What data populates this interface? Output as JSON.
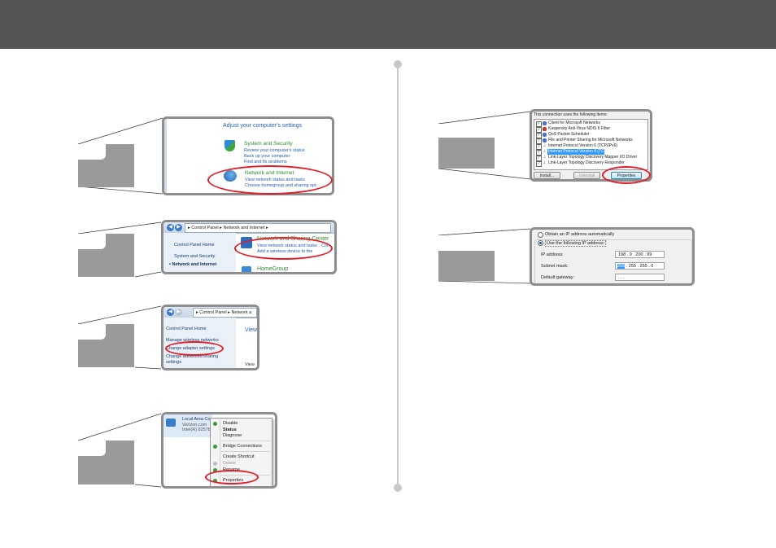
{
  "panel1": {
    "heading": "Adjust your computer's settings",
    "security_title": "System and Security",
    "security_links": [
      "Review your computer's status",
      "Back up your computer",
      "Find and fix problems"
    ],
    "network_title": "Network and Internet",
    "network_links": [
      "View network status and tasks",
      "Choose homegroup and sharing opt"
    ]
  },
  "panel2": {
    "breadcrumb": [
      "Control Panel",
      "Network and Internet"
    ],
    "sidebar": [
      "Control Panel Home",
      "System and Security",
      "Network and Internet"
    ],
    "nsc_title": "Network and Sharing Center",
    "nsc_links": [
      "View network status and tasks",
      "Con",
      "Add a wireless device to the"
    ],
    "homegroup": "HomeGroup"
  },
  "panel3": {
    "breadcrumb": [
      "Control Panel",
      "Network a"
    ],
    "sidebar": [
      "Control Panel Home",
      "Manage wireless networks",
      "Change adapter settings",
      "Change advanced sharing",
      "settings"
    ],
    "main_head": "View",
    "main_foot": "View"
  },
  "panel4": {
    "connection": [
      "Local Area Conn",
      "Verizon.com",
      "Intel(R) 82578 G"
    ],
    "menu": [
      "Disable",
      "Status",
      "Diagnose",
      "Bridge Connections",
      "Create Shortcut",
      "Delete",
      "Rename",
      "Properties"
    ]
  },
  "panel5": {
    "caption": "This connection uses the following items:",
    "items": [
      "Client for Microsoft Networks",
      "Kaspersky Anti-Virus NDIS 6 Filter",
      "QoS Packet Scheduler",
      "File and Printer Sharing for Microsoft Networks",
      "Internet Protocol Version 6 (TCP/IPv6)",
      "Internet Protocol Version 4 (TCP/IPv4)",
      "Link-Layer Topology Discovery Mapper I/O Driver",
      "Link-Layer Topology Discovery Responder"
    ],
    "buttons": [
      "Install...",
      "Uninstall",
      "Properties"
    ]
  },
  "panel6": {
    "auto_option": "Obtain an IP address automatically",
    "manual_option": "Use the following IP address:",
    "labels": [
      "IP address:",
      "Subnet mask:",
      "Default gateway:"
    ],
    "ip_value": "198 .   9  . 200 . 99",
    "mask_first": "255",
    "mask_rest": " . 255 . 255 .  0",
    "gateway_value": "     .       .       ."
  },
  "colors": {
    "header": "#555557",
    "highlight": "#e11d2a",
    "link": "#1e5fb4",
    "frame": "#8e8e8e"
  }
}
